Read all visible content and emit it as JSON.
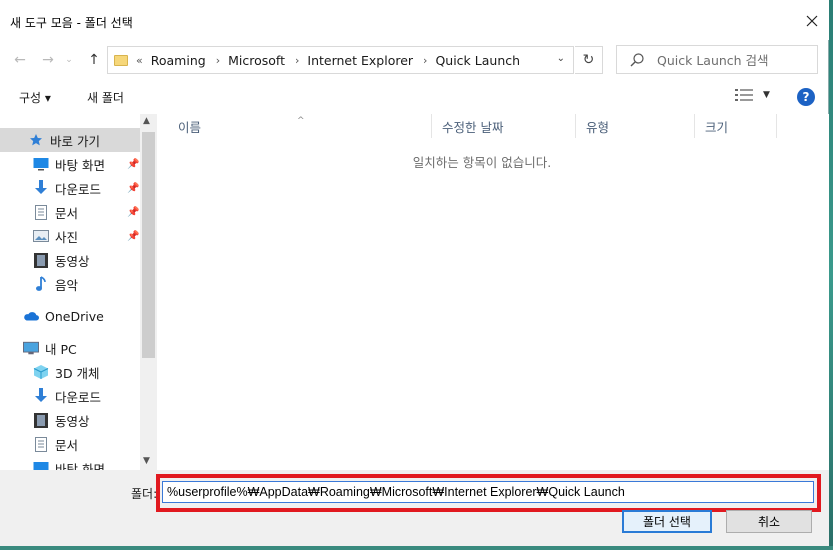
{
  "window": {
    "title": "새 도구 모음 - 폴더 선택"
  },
  "address": {
    "overflow": "«",
    "crumbs": [
      "Roaming",
      "Microsoft",
      "Internet Explorer",
      "Quick Launch"
    ]
  },
  "search": {
    "placeholder": "Quick Launch 검색"
  },
  "toolbar": {
    "organize": "구성 ▾",
    "new_folder": "새 폴더"
  },
  "nav": {
    "quick_access": "바로 가기",
    "items_pinned": [
      "바탕 화면",
      "다운로드",
      "문서",
      "사진"
    ],
    "items_more": [
      "동영상",
      "음악"
    ],
    "onedrive": "OneDrive",
    "this_pc": "내 PC",
    "pc_items": [
      "3D 개체",
      "다운로드",
      "동영상",
      "문서",
      "바탕 화면"
    ]
  },
  "columns": [
    "이름",
    "수정한 날짜",
    "유형",
    "크기"
  ],
  "empty_message": "일치하는 항목이 없습니다.",
  "folder": {
    "label": "폴더:",
    "value": "%userprofile%₩AppData₩Roaming₩Microsoft₩Internet Explorer₩Quick Launch"
  },
  "buttons": {
    "select": "폴더 선택",
    "cancel": "취소"
  },
  "colors": {
    "highlight": "#e1191f",
    "accent": "#1c62c4"
  }
}
